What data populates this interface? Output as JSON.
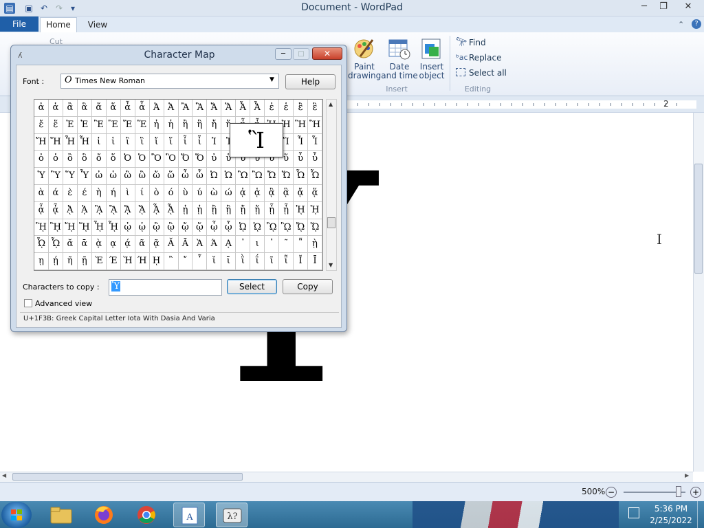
{
  "wordpad": {
    "title": "Document - WordPad",
    "tabs": {
      "file": "File",
      "home": "Home",
      "view": "View"
    },
    "ribbon": {
      "paint_drawing": "Paint drawing",
      "date_time": "Date and time",
      "insert_object": "Insert object",
      "group_insert": "Insert",
      "find": "Find",
      "replace": "Replace",
      "select_all": "Select all",
      "group_editing": "Editing",
      "cut_partial": "Cut"
    },
    "ruler_mark": "2",
    "document_glyph": "Ὑ",
    "zoom": "500%"
  },
  "charmap": {
    "title": "Character Map",
    "font_label": "Font :",
    "font_value": "Times New Roman",
    "help": "Help",
    "zoom_char": "Ἳ",
    "rows": [
      [
        "ἀ",
        "ἁ",
        "ἂ",
        "ἃ",
        "ἄ",
        "ἅ",
        "ἆ",
        "ἇ",
        "Ἀ",
        "Ἁ",
        "Ἂ",
        "Ἃ",
        "Ἄ",
        "Ἅ",
        "Ἆ",
        "Ἇ",
        "ἐ",
        "ἑ",
        "ἒ",
        "ἓ"
      ],
      [
        "ἔ",
        "ἕ",
        "Ἐ",
        "Ἑ",
        "Ἒ",
        "Ἓ",
        "Ἔ",
        "Ἕ",
        "ἠ",
        "ἡ",
        "ἢ",
        "ἣ",
        "ἤ",
        "ἥ",
        "ἦ",
        "ἧ",
        "Ἠ",
        "Ἡ",
        "Ἢ",
        "Ἣ"
      ],
      [
        "Ἤ",
        "Ἥ",
        "Ἦ",
        "Ἧ",
        "ἰ",
        "ἱ",
        "ἲ",
        "ἳ",
        "ἴ",
        "ἵ",
        "ἶ",
        "ἷ",
        "Ἰ",
        "Ἱ",
        "Ἲ",
        "Ἳ",
        "Ἴ",
        "Ἵ",
        "Ἶ",
        "Ἷ"
      ],
      [
        "ὀ",
        "ὁ",
        "ὂ",
        "ὃ",
        "ὄ",
        "ὅ",
        "Ὀ",
        "Ὁ",
        "Ὂ",
        "Ὃ",
        "Ὄ",
        "Ὅ",
        "ὐ",
        "ὑ",
        "ὒ",
        "ὓ",
        "ὔ",
        "ὕ",
        "ὖ",
        "ὗ"
      ],
      [
        "Ὑ",
        "Ὓ",
        "Ὕ",
        "Ὗ",
        "ὠ",
        "ὡ",
        "ὢ",
        "ὣ",
        "ὤ",
        "ὥ",
        "ὦ",
        "ὧ",
        "Ὠ",
        "Ὡ",
        "Ὢ",
        "Ὣ",
        "Ὤ",
        "Ὥ",
        "Ὦ",
        "Ὧ"
      ],
      [
        "ὰ",
        "ά",
        "ὲ",
        "έ",
        "ὴ",
        "ή",
        "ὶ",
        "ί",
        "ὸ",
        "ό",
        "ὺ",
        "ύ",
        "ὼ",
        "ώ",
        "ᾀ",
        "ᾁ",
        "ᾂ",
        "ᾃ",
        "ᾄ",
        "ᾅ"
      ],
      [
        "ᾆ",
        "ᾇ",
        "ᾈ",
        "ᾉ",
        "ᾊ",
        "ᾋ",
        "ᾌ",
        "ᾍ",
        "ᾎ",
        "ᾏ",
        "ᾐ",
        "ᾑ",
        "ᾒ",
        "ᾓ",
        "ᾔ",
        "ᾕ",
        "ᾖ",
        "ᾗ",
        "ᾘ",
        "ᾙ"
      ],
      [
        "ᾚ",
        "ᾛ",
        "ᾜ",
        "ᾝ",
        "ᾞ",
        "ᾟ",
        "ᾠ",
        "ᾡ",
        "ᾢ",
        "ᾣ",
        "ᾤ",
        "ᾥ",
        "ᾦ",
        "ᾧ",
        "ᾨ",
        "ᾩ",
        "ᾪ",
        "ᾫ",
        "ᾬ",
        "ᾭ"
      ],
      [
        "ᾮ",
        "ᾯ",
        "ᾰ",
        "ᾱ",
        "ᾲ",
        "ᾳ",
        "ᾴ",
        "ᾶ",
        "ᾷ",
        "Ᾰ",
        "Ᾱ",
        "Ὰ",
        "Ά",
        "ᾼ",
        "᾽",
        "ι",
        "᾿",
        "῀",
        "῁",
        "ῂ"
      ],
      [
        "ῃ",
        "ῄ",
        "ῆ",
        "ῇ",
        "Ὲ",
        "Έ",
        "Ὴ",
        "Ή",
        "ῌ",
        "῍",
        "῎",
        "῏",
        "ῐ",
        "ῑ",
        "ῒ",
        "ΐ",
        "ῖ",
        "ῗ",
        "Ῐ",
        "Ῑ"
      ]
    ],
    "chars_to_copy_label": "Characters to copy :",
    "chars_to_copy_value": "Ὑ",
    "select": "Select",
    "copy": "Copy",
    "advanced_view": "Advanced view",
    "status": "U+1F3B: Greek Capital Letter Iota With Dasia And Varia"
  },
  "taskbar": {
    "time": "5:36 PM",
    "date": "2/25/2022"
  }
}
